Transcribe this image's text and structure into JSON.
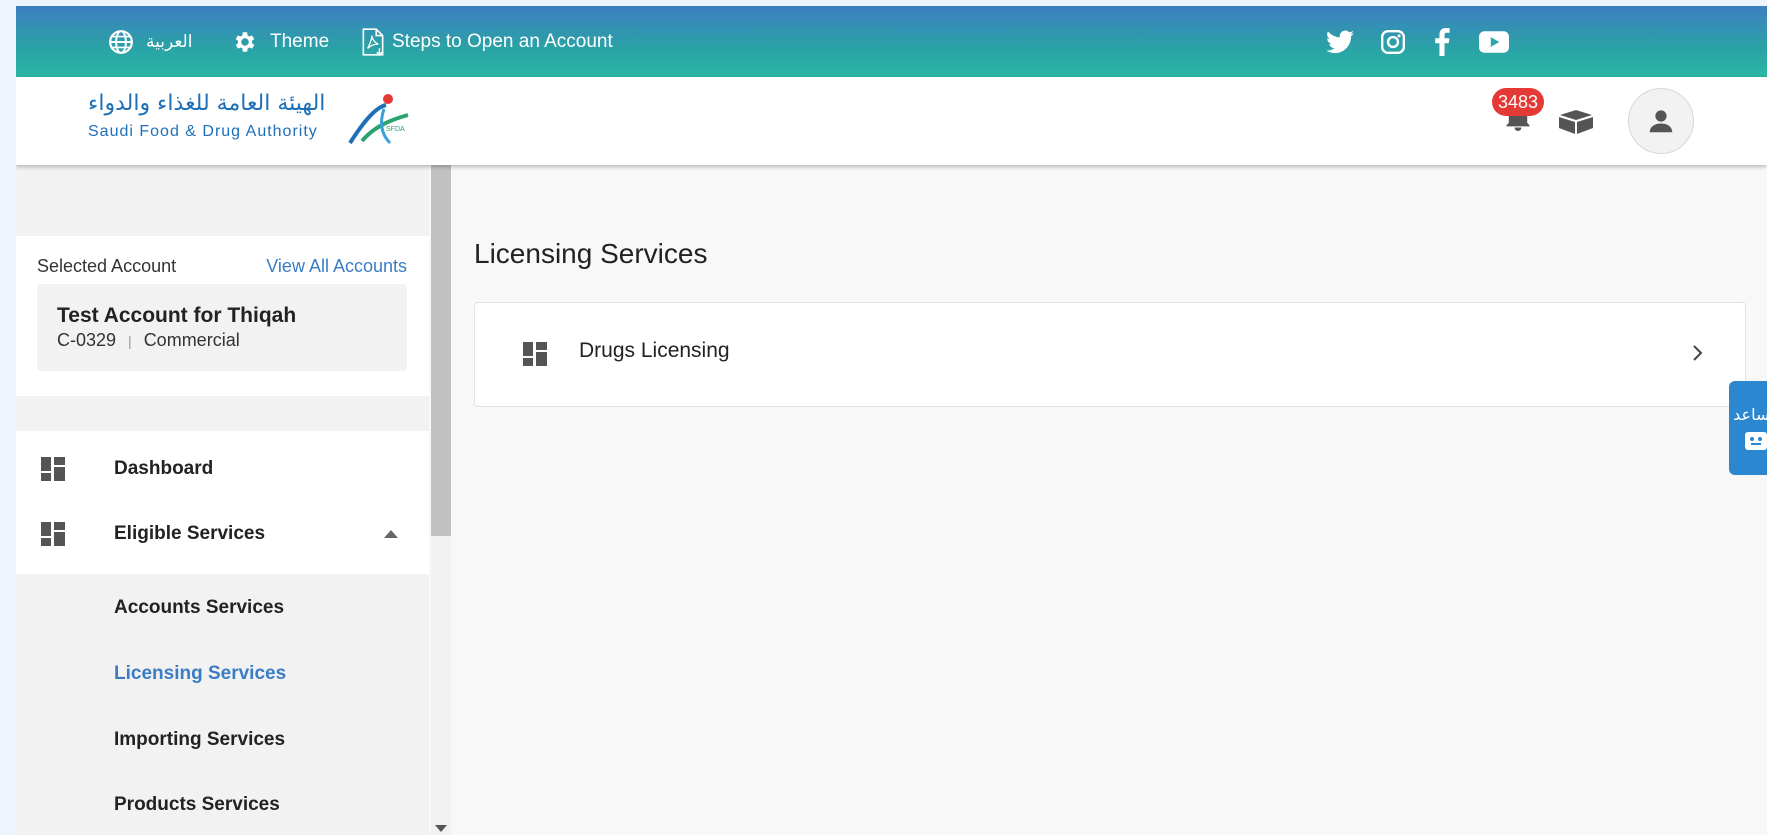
{
  "topbar": {
    "language_label": "العربية",
    "theme_label": "Theme",
    "steps_label": "Steps to Open an Account",
    "social": [
      "twitter-icon",
      "instagram-icon",
      "facebook-icon",
      "youtube-icon"
    ]
  },
  "header": {
    "logo_ar": "الهيئة العامة للغذاء والدواء",
    "logo_en": "Saudi Food & Drug Authority",
    "logo_mark_text": "SFDA",
    "notification_count": "3483"
  },
  "account": {
    "selected_label": "Selected Account",
    "view_all_label": "View All Accounts",
    "name": "Test Account for Thiqah",
    "code": "C-0329",
    "separator": "|",
    "type": "Commercial"
  },
  "menu": {
    "dashboard": "Dashboard",
    "eligible": "Eligible Services",
    "sub_items": [
      "Accounts Services",
      "Licensing Services",
      "Importing Services",
      "Products Services"
    ],
    "active_item": "Licensing Services"
  },
  "main": {
    "title": "Licensing Services",
    "cards": [
      {
        "label": "Drugs Licensing"
      }
    ]
  },
  "side_tab": {
    "label": "مساعد"
  },
  "colors": {
    "accent": "#3b7dc4",
    "topbar_start": "#3d7fc1",
    "topbar_end": "#2bb7a3",
    "badge": "#e53935"
  }
}
